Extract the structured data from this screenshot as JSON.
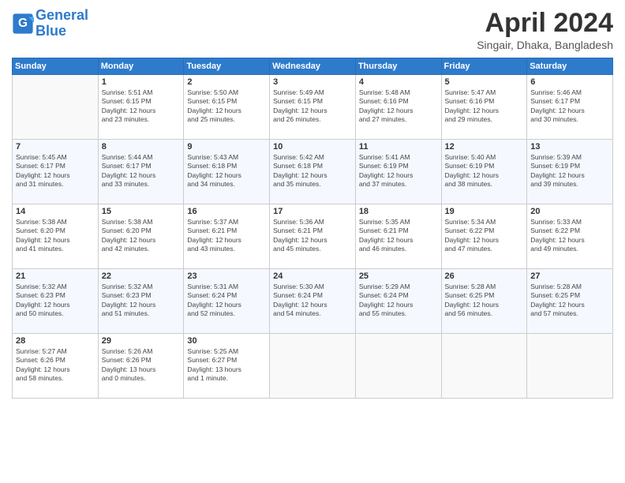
{
  "header": {
    "logo_line1": "General",
    "logo_line2": "Blue",
    "title": "April 2024",
    "location": "Singair, Dhaka, Bangladesh"
  },
  "days_header": [
    "Sunday",
    "Monday",
    "Tuesday",
    "Wednesday",
    "Thursday",
    "Friday",
    "Saturday"
  ],
  "weeks": [
    [
      {
        "day": "",
        "info": ""
      },
      {
        "day": "1",
        "info": "Sunrise: 5:51 AM\nSunset: 6:15 PM\nDaylight: 12 hours\nand 23 minutes."
      },
      {
        "day": "2",
        "info": "Sunrise: 5:50 AM\nSunset: 6:15 PM\nDaylight: 12 hours\nand 25 minutes."
      },
      {
        "day": "3",
        "info": "Sunrise: 5:49 AM\nSunset: 6:15 PM\nDaylight: 12 hours\nand 26 minutes."
      },
      {
        "day": "4",
        "info": "Sunrise: 5:48 AM\nSunset: 6:16 PM\nDaylight: 12 hours\nand 27 minutes."
      },
      {
        "day": "5",
        "info": "Sunrise: 5:47 AM\nSunset: 6:16 PM\nDaylight: 12 hours\nand 29 minutes."
      },
      {
        "day": "6",
        "info": "Sunrise: 5:46 AM\nSunset: 6:17 PM\nDaylight: 12 hours\nand 30 minutes."
      }
    ],
    [
      {
        "day": "7",
        "info": "Sunrise: 5:45 AM\nSunset: 6:17 PM\nDaylight: 12 hours\nand 31 minutes."
      },
      {
        "day": "8",
        "info": "Sunrise: 5:44 AM\nSunset: 6:17 PM\nDaylight: 12 hours\nand 33 minutes."
      },
      {
        "day": "9",
        "info": "Sunrise: 5:43 AM\nSunset: 6:18 PM\nDaylight: 12 hours\nand 34 minutes."
      },
      {
        "day": "10",
        "info": "Sunrise: 5:42 AM\nSunset: 6:18 PM\nDaylight: 12 hours\nand 35 minutes."
      },
      {
        "day": "11",
        "info": "Sunrise: 5:41 AM\nSunset: 6:19 PM\nDaylight: 12 hours\nand 37 minutes."
      },
      {
        "day": "12",
        "info": "Sunrise: 5:40 AM\nSunset: 6:19 PM\nDaylight: 12 hours\nand 38 minutes."
      },
      {
        "day": "13",
        "info": "Sunrise: 5:39 AM\nSunset: 6:19 PM\nDaylight: 12 hours\nand 39 minutes."
      }
    ],
    [
      {
        "day": "14",
        "info": "Sunrise: 5:38 AM\nSunset: 6:20 PM\nDaylight: 12 hours\nand 41 minutes."
      },
      {
        "day": "15",
        "info": "Sunrise: 5:38 AM\nSunset: 6:20 PM\nDaylight: 12 hours\nand 42 minutes."
      },
      {
        "day": "16",
        "info": "Sunrise: 5:37 AM\nSunset: 6:21 PM\nDaylight: 12 hours\nand 43 minutes."
      },
      {
        "day": "17",
        "info": "Sunrise: 5:36 AM\nSunset: 6:21 PM\nDaylight: 12 hours\nand 45 minutes."
      },
      {
        "day": "18",
        "info": "Sunrise: 5:35 AM\nSunset: 6:21 PM\nDaylight: 12 hours\nand 46 minutes."
      },
      {
        "day": "19",
        "info": "Sunrise: 5:34 AM\nSunset: 6:22 PM\nDaylight: 12 hours\nand 47 minutes."
      },
      {
        "day": "20",
        "info": "Sunrise: 5:33 AM\nSunset: 6:22 PM\nDaylight: 12 hours\nand 49 minutes."
      }
    ],
    [
      {
        "day": "21",
        "info": "Sunrise: 5:32 AM\nSunset: 6:23 PM\nDaylight: 12 hours\nand 50 minutes."
      },
      {
        "day": "22",
        "info": "Sunrise: 5:32 AM\nSunset: 6:23 PM\nDaylight: 12 hours\nand 51 minutes."
      },
      {
        "day": "23",
        "info": "Sunrise: 5:31 AM\nSunset: 6:24 PM\nDaylight: 12 hours\nand 52 minutes."
      },
      {
        "day": "24",
        "info": "Sunrise: 5:30 AM\nSunset: 6:24 PM\nDaylight: 12 hours\nand 54 minutes."
      },
      {
        "day": "25",
        "info": "Sunrise: 5:29 AM\nSunset: 6:24 PM\nDaylight: 12 hours\nand 55 minutes."
      },
      {
        "day": "26",
        "info": "Sunrise: 5:28 AM\nSunset: 6:25 PM\nDaylight: 12 hours\nand 56 minutes."
      },
      {
        "day": "27",
        "info": "Sunrise: 5:28 AM\nSunset: 6:25 PM\nDaylight: 12 hours\nand 57 minutes."
      }
    ],
    [
      {
        "day": "28",
        "info": "Sunrise: 5:27 AM\nSunset: 6:26 PM\nDaylight: 12 hours\nand 58 minutes."
      },
      {
        "day": "29",
        "info": "Sunrise: 5:26 AM\nSunset: 6:26 PM\nDaylight: 13 hours\nand 0 minutes."
      },
      {
        "day": "30",
        "info": "Sunrise: 5:25 AM\nSunset: 6:27 PM\nDaylight: 13 hours\nand 1 minute."
      },
      {
        "day": "",
        "info": ""
      },
      {
        "day": "",
        "info": ""
      },
      {
        "day": "",
        "info": ""
      },
      {
        "day": "",
        "info": ""
      }
    ]
  ]
}
